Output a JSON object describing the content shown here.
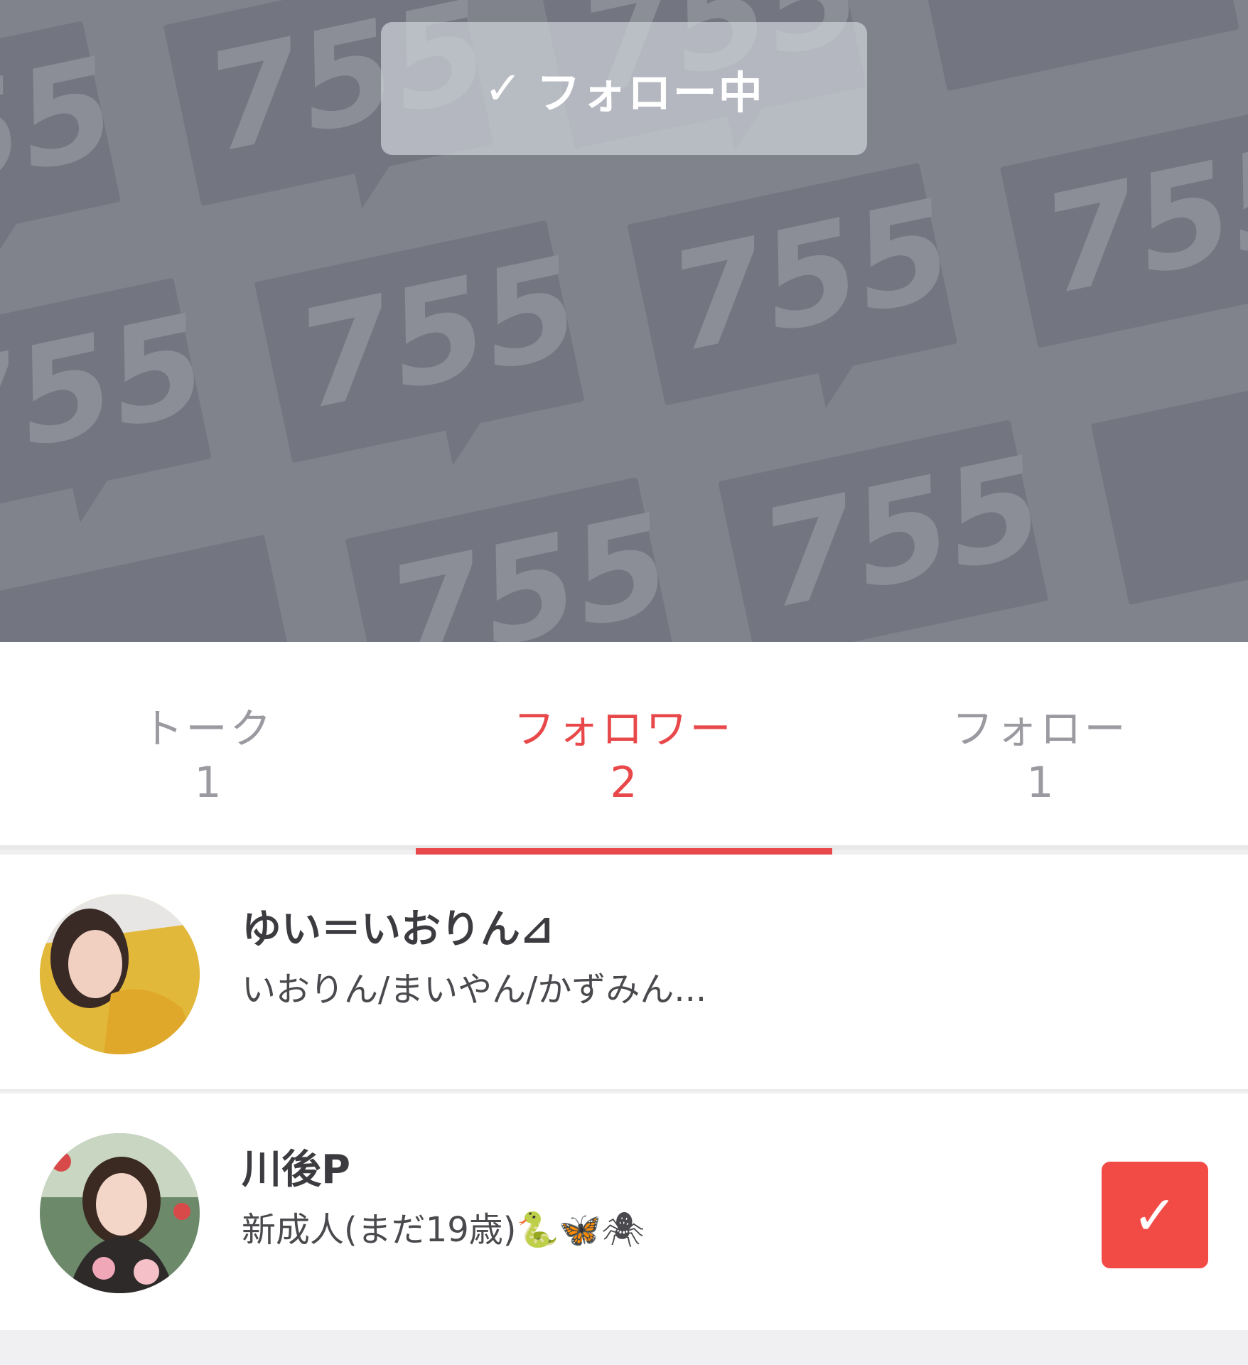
{
  "header": {
    "follow_button": {
      "check_icon": "check-icon",
      "label": "フォロー中"
    },
    "background_pattern_text": "755",
    "background_color": "#80838c"
  },
  "tabs": [
    {
      "label": "トーク",
      "count": "1",
      "active": false
    },
    {
      "label": "フォロワー",
      "count": "2",
      "active": true
    },
    {
      "label": "フォロー",
      "count": "1",
      "active": false
    }
  ],
  "accent_color": "#e8484a",
  "users": [
    {
      "name": "ゆい＝いおりん⊿",
      "bio": "いおりん/まいやん/かずみん..."
    },
    {
      "name": "川後P",
      "bio": "新成人(まだ19歳)🐍🦋🕷",
      "follow_back_icon": "check-icon"
    }
  ]
}
